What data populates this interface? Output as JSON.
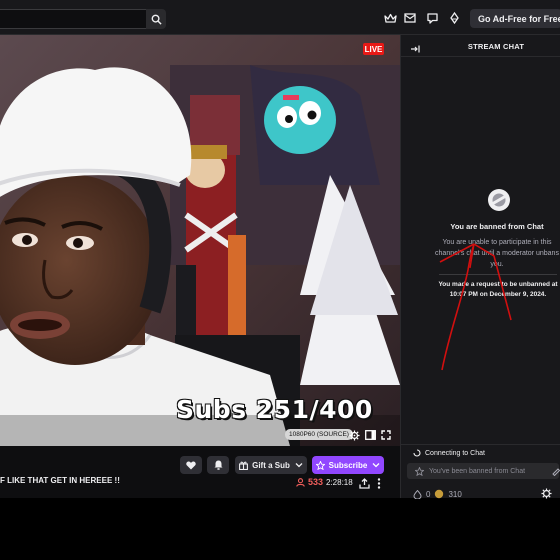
{
  "topbar": {
    "search_placeholder": "",
    "adfree_label": "Go Ad-Free for Free",
    "icons": [
      "search-icon",
      "crown-icon",
      "mail-icon",
      "chat-bubble-icon",
      "drop-icon",
      "ad-free-icon"
    ]
  },
  "video": {
    "live_label": "LIVE",
    "overlay_text": "Subs 251/400",
    "quality_label": "1080P60 (SOURCE)"
  },
  "info": {
    "stream_title": "F LIKE THAT GET IN HEREEE !!",
    "gift_label": "Gift a Sub",
    "subscribe_label": "Subscribe",
    "viewer_count": "533",
    "uptime": "2:28:18"
  },
  "chat": {
    "title": "STREAM CHAT",
    "ban_title": "You are banned from Chat",
    "ban_desc": "You are unable to participate in this channel's chat until a moderator unbans you.",
    "ban_request": "You made a request to be unbanned at 10:07 PM on December 9, 2024.",
    "connecting": "Connecting to Chat",
    "input_placeholder": "You've been banned from Chat",
    "points": "0",
    "points2": "310"
  },
  "colors": {
    "accent": "#9147ff",
    "live": "#e91916",
    "annotation": "#d10f0f",
    "viewers": "#f25f5c"
  }
}
